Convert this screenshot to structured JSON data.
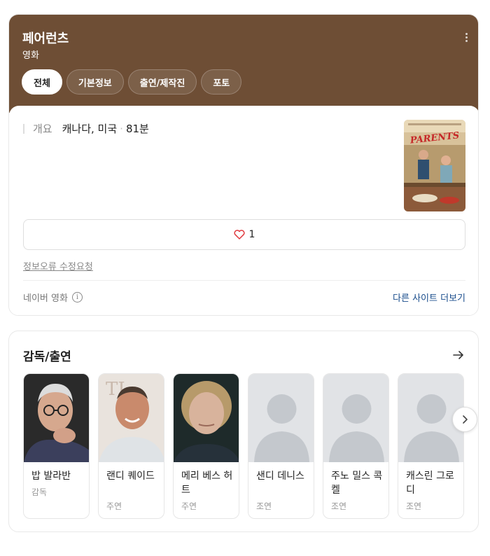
{
  "header": {
    "title": "페어런츠",
    "subtitle": "영화",
    "tabs": [
      {
        "label": "전체",
        "active": true
      },
      {
        "label": "기본정보",
        "active": false
      },
      {
        "label": "출연/제작진",
        "active": false
      },
      {
        "label": "포토",
        "active": false
      }
    ]
  },
  "overview": {
    "label": "개요",
    "country": "캐나다, 미국",
    "runtime": "81분"
  },
  "like": {
    "count": "1"
  },
  "report_link": "정보오류 수정요청",
  "source": {
    "name": "네이버 영화",
    "info": "i"
  },
  "other_sites": "다른 사이트 더보기",
  "cast_section": {
    "title": "감독/출연",
    "people": [
      {
        "name": "밥 발라반",
        "role": "감독"
      },
      {
        "name": "랜디 퀘이드",
        "role": "주연"
      },
      {
        "name": "메리 베스 허트",
        "role": "주연"
      },
      {
        "name": "샌디 데니스",
        "role": "조연"
      },
      {
        "name": "주노 밀스 콕켈",
        "role": "조연"
      },
      {
        "name": "캐스린 그로디",
        "role": "조연"
      }
    ]
  },
  "colors": {
    "hero_bg": "#6e4e35",
    "link": "#1a4d8c",
    "heart": "#e0393e"
  }
}
